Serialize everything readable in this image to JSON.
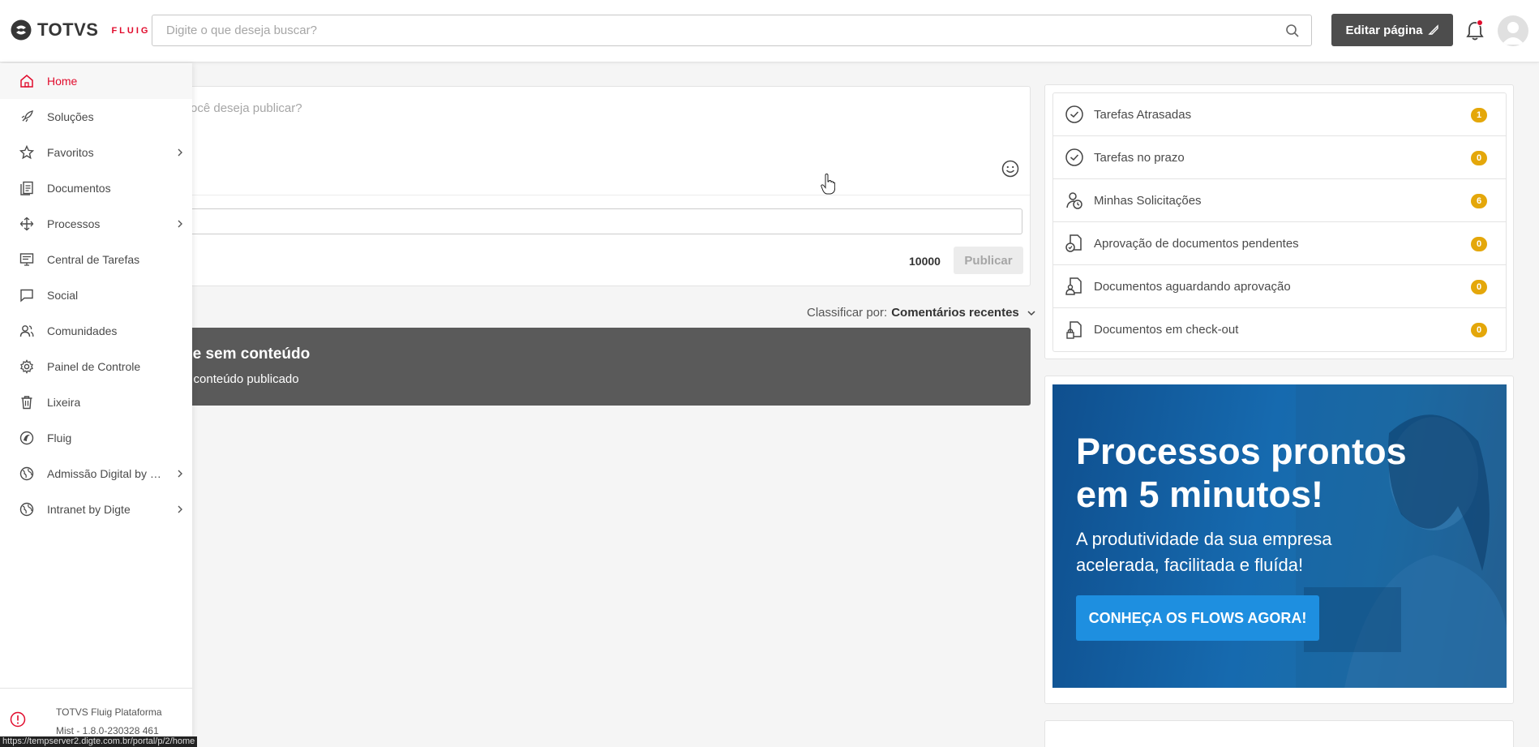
{
  "header": {
    "logo_text": "TOTVS",
    "logo_sub": "FLUIG",
    "search_placeholder": "Digite o que deseja buscar?",
    "edit_label": "Editar página"
  },
  "sidebar": {
    "items": [
      {
        "label": "Home",
        "icon": "home-icon",
        "active": true
      },
      {
        "label": "Soluções",
        "icon": "rocket-icon"
      },
      {
        "label": "Favoritos",
        "icon": "star-icon",
        "submenu": true
      },
      {
        "label": "Documentos",
        "icon": "documents-icon"
      },
      {
        "label": "Processos",
        "icon": "process-icon",
        "submenu": true
      },
      {
        "label": "Central de Tarefas",
        "icon": "task-center-icon"
      },
      {
        "label": "Social",
        "icon": "chat-icon"
      },
      {
        "label": "Comunidades",
        "icon": "people-icon"
      },
      {
        "label": "Painel de Controle",
        "icon": "gear-icon"
      },
      {
        "label": "Lixeira",
        "icon": "trash-icon"
      },
      {
        "label": "Fluig",
        "icon": "fluig-icon"
      },
      {
        "label": "Admissão Digital by D...",
        "icon": "globe-icon",
        "submenu": true
      },
      {
        "label": "Intranet by Digte",
        "icon": "globe-icon",
        "submenu": true
      }
    ],
    "footer_line1": "TOTVS Fluig Plataforma",
    "footer_line2": "Mist - 1.8.0-230328 461"
  },
  "status_url": "https://tempserver2.digte.com.br/portal/p/2/home",
  "publish": {
    "placeholder": "ocê deseja publicar?",
    "char_count": "10000",
    "button": "Publicar"
  },
  "sort": {
    "label": "Classificar por:",
    "value": "Comentários recentes"
  },
  "empty": {
    "title": "ne sem conteúdo",
    "subtitle": "e conteúdo publicado"
  },
  "tasks": [
    {
      "label": "Tarefas Atrasadas",
      "count": "1",
      "icon": "clock-check-icon"
    },
    {
      "label": "Tarefas no prazo",
      "count": "0",
      "icon": "clock-check-icon"
    },
    {
      "label": "Minhas Solicitações",
      "count": "6",
      "icon": "user-clock-icon"
    },
    {
      "label": "Aprovação de documentos pendentes",
      "count": "0",
      "icon": "document-clock-icon"
    },
    {
      "label": "Documentos aguardando aprovação",
      "count": "0",
      "icon": "document-user-icon"
    },
    {
      "label": "Documentos em check-out",
      "count": "0",
      "icon": "document-lock-icon"
    }
  ],
  "promo": {
    "title_line1": "Processos prontos",
    "title_line2": "em 5 minutos!",
    "sub_line1": "A produtividade da sua empresa",
    "sub_line2": "acelerada, facilitada e fluída!",
    "button": "CONHEÇA OS FLOWS AGORA!"
  },
  "colors": {
    "brand_red": "#e10b2c",
    "badge": "#e4a70a",
    "promo_blue": "#166aaf",
    "dark_button": "#4d4d4d"
  }
}
